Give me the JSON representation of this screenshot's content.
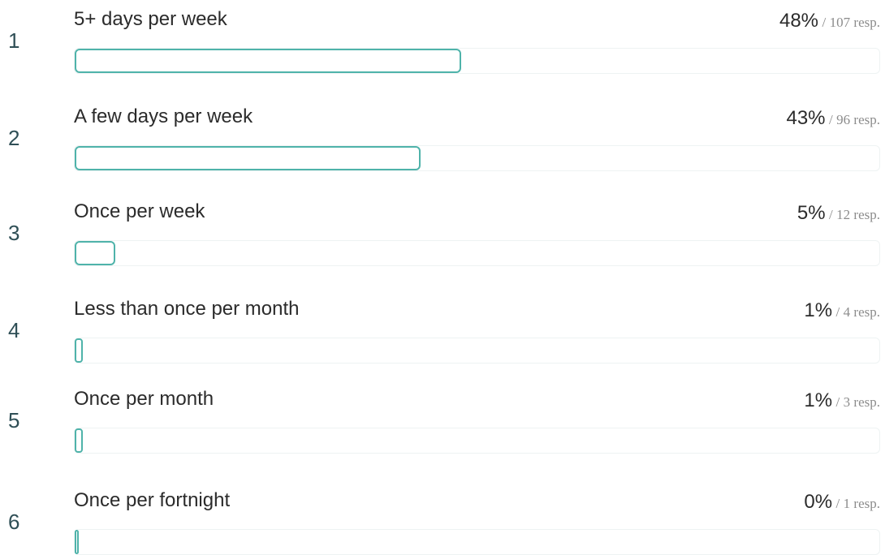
{
  "accent_color": "#4fb3aa",
  "answers": [
    {
      "rank": "1",
      "label": "5+ days per week",
      "percent_text": "48%",
      "separator": "/",
      "responses_text": "107 resp.",
      "fraction": 0.48
    },
    {
      "rank": "2",
      "label": "A few days per week",
      "percent_text": "43%",
      "separator": "/",
      "responses_text": "96 resp.",
      "fraction": 0.43
    },
    {
      "rank": "3",
      "label": "Once per week",
      "percent_text": "5%",
      "separator": "/",
      "responses_text": "12 resp.",
      "fraction": 0.05
    },
    {
      "rank": "4",
      "label": "Less than once per month",
      "percent_text": "1%",
      "separator": "/",
      "responses_text": "4 resp.",
      "fraction": 0.01
    },
    {
      "rank": "5",
      "label": "Once per month",
      "percent_text": "1%",
      "separator": "/",
      "responses_text": "3 resp.",
      "fraction": 0.01
    },
    {
      "rank": "6",
      "label": "Once per fortnight",
      "percent_text": "0%",
      "separator": "/",
      "responses_text": "1 resp.",
      "fraction": 0.0
    }
  ]
}
